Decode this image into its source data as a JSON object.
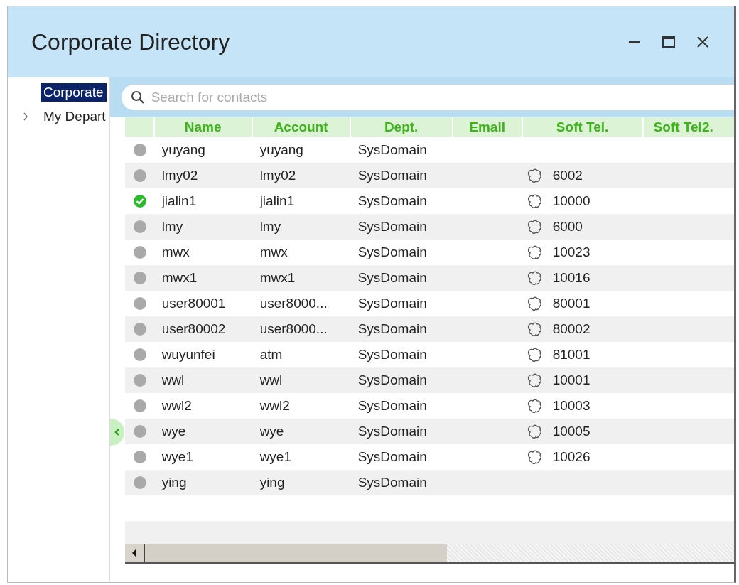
{
  "window": {
    "title": "Corporate Directory"
  },
  "sidebar": {
    "items": [
      {
        "label": "Corporate",
        "selected": true,
        "kind": "root"
      },
      {
        "label": "My Depart",
        "selected": false,
        "kind": "group",
        "expanded": false
      }
    ]
  },
  "search": {
    "placeholder": "Search for contacts"
  },
  "table": {
    "columns": [
      "Name",
      "Account",
      "Dept.",
      "Email",
      "Soft Tel.",
      "Soft Tel2."
    ],
    "rows": [
      {
        "online": false,
        "name": "yuyang",
        "account": "yuyang",
        "dept": "SysDomain"
      },
      {
        "online": false,
        "name": "lmy02",
        "account": "lmy02",
        "dept": "SysDomain",
        "soft_tel": "6002"
      },
      {
        "online": true,
        "name": "jialin1",
        "account": "jialin1",
        "dept": "SysDomain",
        "soft_tel": "10000"
      },
      {
        "online": false,
        "name": "lmy",
        "account": "lmy",
        "dept": "SysDomain",
        "soft_tel": "6000"
      },
      {
        "online": false,
        "name": "mwx",
        "account": "mwx",
        "dept": "SysDomain",
        "soft_tel": "10023"
      },
      {
        "online": false,
        "name": "mwx1",
        "account": "mwx1",
        "dept": "SysDomain",
        "soft_tel": "10016"
      },
      {
        "online": false,
        "name": "user80001",
        "account": "user8000...",
        "dept": "SysDomain",
        "soft_tel": "80001"
      },
      {
        "online": false,
        "name": "user80002",
        "account": "user8000...",
        "dept": "SysDomain",
        "soft_tel": "80002"
      },
      {
        "online": false,
        "name": "wuyunfei",
        "account": "atm",
        "dept": "SysDomain",
        "soft_tel": "81001"
      },
      {
        "online": false,
        "name": "wwl",
        "account": "wwl",
        "dept": "SysDomain",
        "soft_tel": "10001"
      },
      {
        "online": false,
        "name": "wwl2",
        "account": "wwl2",
        "dept": "SysDomain",
        "soft_tel": "10003"
      },
      {
        "online": false,
        "name": "wye",
        "account": "wye",
        "dept": "SysDomain",
        "soft_tel": "10005"
      },
      {
        "online": false,
        "name": "wye1",
        "account": "wye1",
        "dept": "SysDomain",
        "soft_tel": "10026"
      },
      {
        "online": false,
        "name": "ying",
        "account": "ying",
        "dept": "SysDomain"
      }
    ]
  }
}
